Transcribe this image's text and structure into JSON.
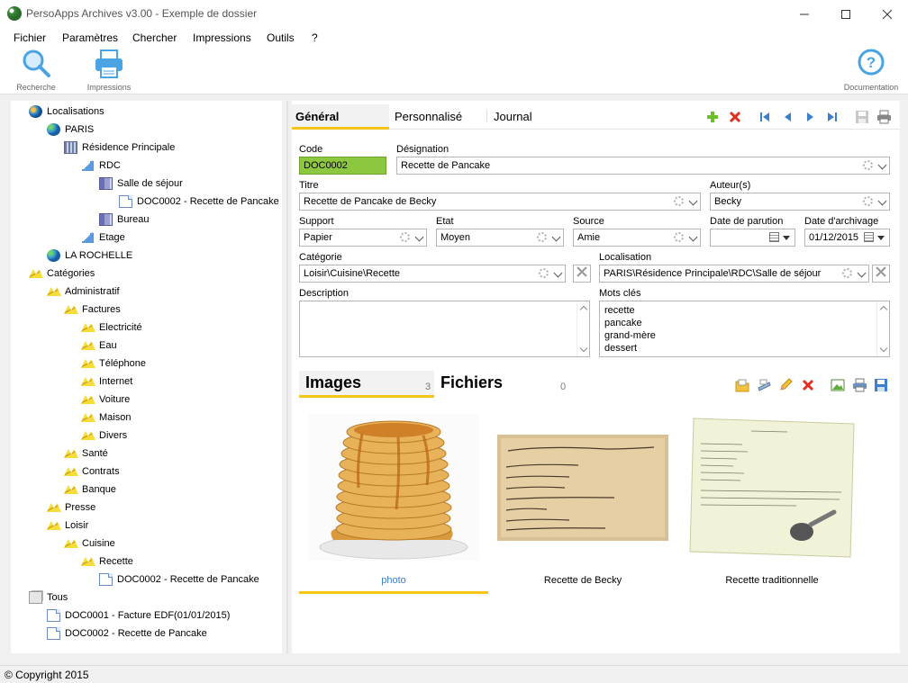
{
  "window": {
    "title": "PersoApps Archives v3.00 - Exemple de dossier"
  },
  "menu": [
    "Fichier",
    "Paramètres",
    "Chercher",
    "Impressions",
    "Outils",
    "?"
  ],
  "toolbar": {
    "search_label": "Recherche",
    "print_label": "Impressions",
    "doc_label": "Documentation"
  },
  "tree": {
    "localisations": "Localisations",
    "paris": "PARIS",
    "residence": "Résidence Principale",
    "rdc": "RDC",
    "salle": "Salle de séjour",
    "doc_salle": "DOC0002 - Recette de Pancake",
    "bureau": "Bureau",
    "etage": "Etage",
    "rochelle": "LA ROCHELLE",
    "categories": "Catégories",
    "administratif": "Administratif",
    "factures": "Factures",
    "electricite": "Electricité",
    "eau": "Eau",
    "telephone": "Téléphone",
    "internet": "Internet",
    "voiture": "Voiture",
    "maison": "Maison",
    "divers": "Divers",
    "sante": "Santé",
    "contrats": "Contrats",
    "banque": "Banque",
    "presse": "Presse",
    "loisir": "Loisir",
    "cuisine": "Cuisine",
    "recette": "Recette",
    "doc_recette": "DOC0002 - Recette de Pancake",
    "tous": "Tous",
    "doc1": "DOC0001 - Facture EDF(01/01/2015)",
    "doc2": "DOC0002 - Recette de Pancake"
  },
  "tabs": {
    "general": "Général",
    "perso": "Personnalisé",
    "journal": "Journal"
  },
  "form": {
    "code_label": "Code",
    "code": "DOC0002",
    "designation_label": "Désignation",
    "designation": "Recette de Pancake",
    "titre_label": "Titre",
    "titre": "Recette de Pancake de Becky",
    "auteur_label": "Auteur(s)",
    "auteur": "Becky",
    "support_label": "Support",
    "support": "Papier",
    "etat_label": "Etat",
    "etat": "Moyen",
    "source_label": "Source",
    "source": "Amie",
    "parution_label": "Date de parution",
    "parution": "",
    "archivage_label": "Date d'archivage",
    "archivage": "01/12/2015",
    "categorie_label": "Catégorie",
    "categorie": "Loisir\\Cuisine\\Recette",
    "localisation_label": "Localisation",
    "localisation": "PARIS\\Résidence Principale\\RDC\\Salle de séjour",
    "description_label": "Description",
    "description": "",
    "motscles_label": "Mots clés",
    "motscles": [
      "recette",
      "pancake",
      "grand-mère",
      "dessert"
    ]
  },
  "subtabs": {
    "images": "Images",
    "images_count": "3",
    "fichiers": "Fichiers",
    "fichiers_count": "0"
  },
  "gallery": [
    {
      "caption": "photo"
    },
    {
      "caption": "Recette de Becky"
    },
    {
      "caption": "Recette traditionnelle"
    }
  ],
  "status": {
    "copyright": "© Copyright 2015"
  },
  "colors": {
    "accent": "#f5c518",
    "code_bg": "#8dc63f",
    "link": "#3d7cc9"
  }
}
